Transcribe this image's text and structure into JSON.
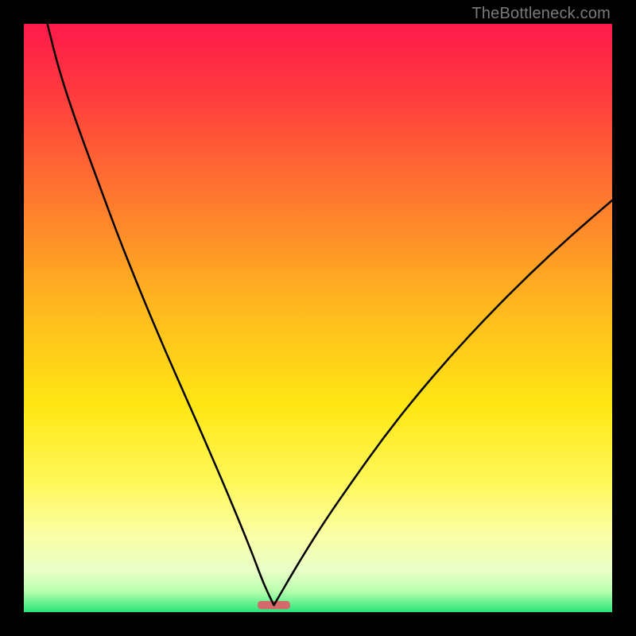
{
  "watermark": "TheBottleneck.com",
  "chart_data": {
    "type": "line",
    "title": "",
    "xlabel": "",
    "ylabel": "",
    "xlim": [
      0,
      100
    ],
    "ylim": [
      0,
      100
    ],
    "grid": false,
    "legend": false,
    "background_gradient": {
      "stops": [
        {
          "offset": 0.0,
          "color": "#ff1a4b"
        },
        {
          "offset": 0.12,
          "color": "#ff3b3e"
        },
        {
          "offset": 0.3,
          "color": "#ff7a2e"
        },
        {
          "offset": 0.48,
          "color": "#ffb81f"
        },
        {
          "offset": 0.65,
          "color": "#ffe714"
        },
        {
          "offset": 0.78,
          "color": "#fff85a"
        },
        {
          "offset": 0.87,
          "color": "#fbffa6"
        },
        {
          "offset": 0.93,
          "color": "#e9ffc8"
        },
        {
          "offset": 0.965,
          "color": "#b7ffac"
        },
        {
          "offset": 1.0,
          "color": "#28e57a"
        }
      ]
    },
    "marker": {
      "x": 42.5,
      "y": 1.2,
      "width": 5.5,
      "height": 1.4,
      "color": "#d26a6a",
      "rx": 4
    },
    "series": [
      {
        "name": "left-curve",
        "color": "#000000",
        "stroke_width": 2.5,
        "points": [
          {
            "x": 4.0,
            "y": 100.0
          },
          {
            "x": 6.0,
            "y": 92.0
          },
          {
            "x": 9.0,
            "y": 83.0
          },
          {
            "x": 12.5,
            "y": 73.5
          },
          {
            "x": 16.0,
            "y": 64.0
          },
          {
            "x": 20.0,
            "y": 54.0
          },
          {
            "x": 24.0,
            "y": 44.5
          },
          {
            "x": 28.0,
            "y": 35.5
          },
          {
            "x": 31.5,
            "y": 27.5
          },
          {
            "x": 34.5,
            "y": 20.5
          },
          {
            "x": 37.0,
            "y": 14.5
          },
          {
            "x": 39.0,
            "y": 9.5
          },
          {
            "x": 40.5,
            "y": 5.5
          },
          {
            "x": 41.7,
            "y": 2.8
          },
          {
            "x": 42.5,
            "y": 1.2
          }
        ]
      },
      {
        "name": "right-curve",
        "color": "#000000",
        "stroke_width": 2.5,
        "points": [
          {
            "x": 42.5,
            "y": 1.2
          },
          {
            "x": 43.5,
            "y": 2.9
          },
          {
            "x": 45.3,
            "y": 6.0
          },
          {
            "x": 48.0,
            "y": 10.5
          },
          {
            "x": 51.5,
            "y": 16.0
          },
          {
            "x": 56.0,
            "y": 22.5
          },
          {
            "x": 61.0,
            "y": 29.5
          },
          {
            "x": 66.5,
            "y": 36.5
          },
          {
            "x": 72.5,
            "y": 43.5
          },
          {
            "x": 79.0,
            "y": 50.5
          },
          {
            "x": 86.0,
            "y": 57.5
          },
          {
            "x": 93.0,
            "y": 64.0
          },
          {
            "x": 100.0,
            "y": 70.0
          }
        ]
      }
    ]
  }
}
